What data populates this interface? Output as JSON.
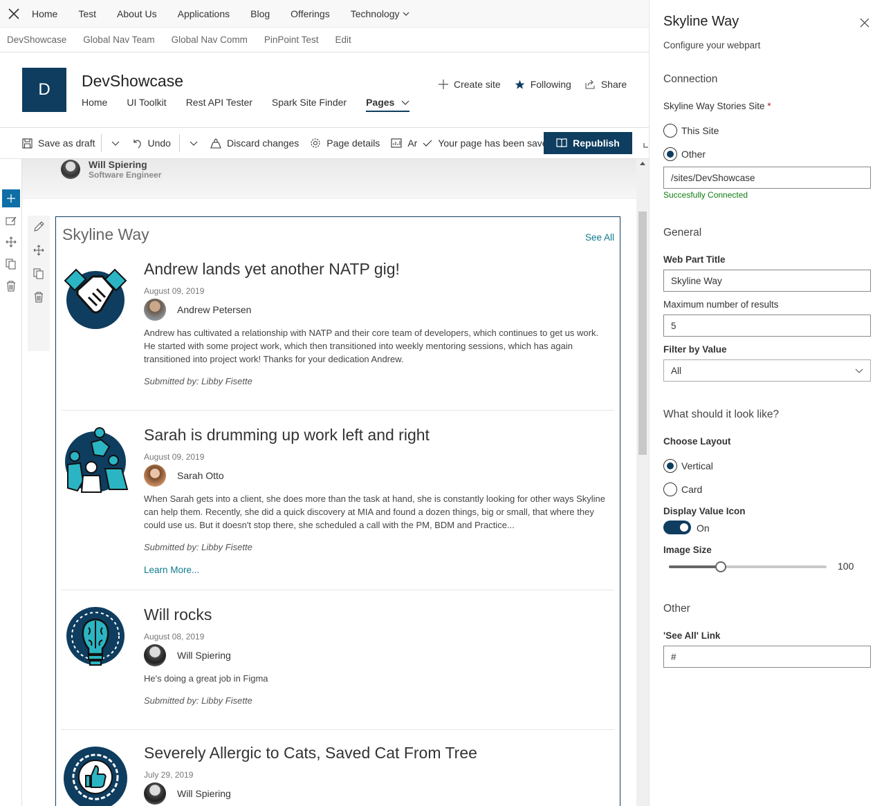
{
  "top_nav": {
    "links": [
      "Home",
      "Test",
      "About Us",
      "Applications",
      "Blog",
      "Offerings",
      "Technology"
    ]
  },
  "sub_nav": {
    "links": [
      "DevShowcase",
      "Global Nav Team",
      "Global Nav Comm",
      "PinPoint Test",
      "Edit"
    ]
  },
  "site": {
    "logo_letter": "D",
    "title": "DevShowcase",
    "links": [
      "Home",
      "UI Toolkit",
      "Rest API Tester",
      "Spark Site Finder"
    ],
    "active_link": "Pages",
    "actions": {
      "create": "Create site",
      "following": "Following",
      "share": "Share"
    }
  },
  "command_bar": {
    "save_draft": "Save as draft",
    "undo": "Undo",
    "discard": "Discard changes",
    "page_details": "Page details",
    "truncated": "Ar",
    "saved_status": "Your page has been saved",
    "republish": "Republish"
  },
  "hero": {
    "author_name": "Will Spiering",
    "author_role": "Software Engineer"
  },
  "webpart": {
    "title": "Skyline Way",
    "see_all": "See All",
    "stories": [
      {
        "title": "Andrew lands yet another NATP gig!",
        "date": "August 09, 2019",
        "person": "Andrew Petersen",
        "body": "Andrew has cultivated a relationship with NATP and their core team of developers, which continues to get us work. He started with some project work, which then transitioned into weekly mentoring sessions, which has again transitioned into project work! Thanks for your dedication Andrew.",
        "submitted": "Submitted by: Libby Fisette"
      },
      {
        "title": "Sarah is drumming up work left and right",
        "date": "August 09, 2019",
        "person": "Sarah Otto",
        "body": "When Sarah gets into a client, she does more than the task at hand, she is constantly looking for other ways Skyline can help them. Recently, she did a quick discovery at MIA and found a dozen things, big or small, that where they could use us. But it doesn't stop there, she scheduled a call with the PM, BDM and Practice...",
        "submitted": "Submitted by: Libby Fisette",
        "learn_more": "Learn More..."
      },
      {
        "title": "Will rocks",
        "date": "August 08, 2019",
        "person": "Will Spiering",
        "body": "He's doing a great job in Figma",
        "submitted": "Submitted by: Libby Fisette"
      },
      {
        "title": "Severely Allergic to Cats, Saved Cat From Tree",
        "date": "July 29, 2019",
        "person": "Will Spiering"
      }
    ]
  },
  "pane": {
    "title": "Skyline Way",
    "subtitle": "Configure your webpart",
    "connection": {
      "heading": "Connection",
      "site_label": "Skyline Way Stories Site",
      "required_mark": "*",
      "option_this": "This Site",
      "option_other": "Other",
      "selected": "Other",
      "site_value": "/sites/DevShowcase",
      "status": "Succesfully Connected"
    },
    "general": {
      "heading": "General",
      "title_label": "Web Part Title",
      "title_value": "Skyline Way",
      "max_label": "Maximum number of results",
      "max_value": "5",
      "filter_label": "Filter by Value",
      "filter_value": "All"
    },
    "look": {
      "heading": "What should it look like?",
      "layout_label": "Choose Layout",
      "option_vertical": "Vertical",
      "option_card": "Card",
      "selected": "Vertical",
      "icon_label": "Display Value Icon",
      "icon_state": "On",
      "size_label": "Image Size",
      "size_value": "100",
      "size_fraction": 0.33
    },
    "other": {
      "heading": "Other",
      "link_label": "'See All' Link",
      "link_value": "#"
    }
  },
  "colors": {
    "accent": "#0e3d5f",
    "link": "#0e7a8c",
    "success": "#107c10"
  }
}
